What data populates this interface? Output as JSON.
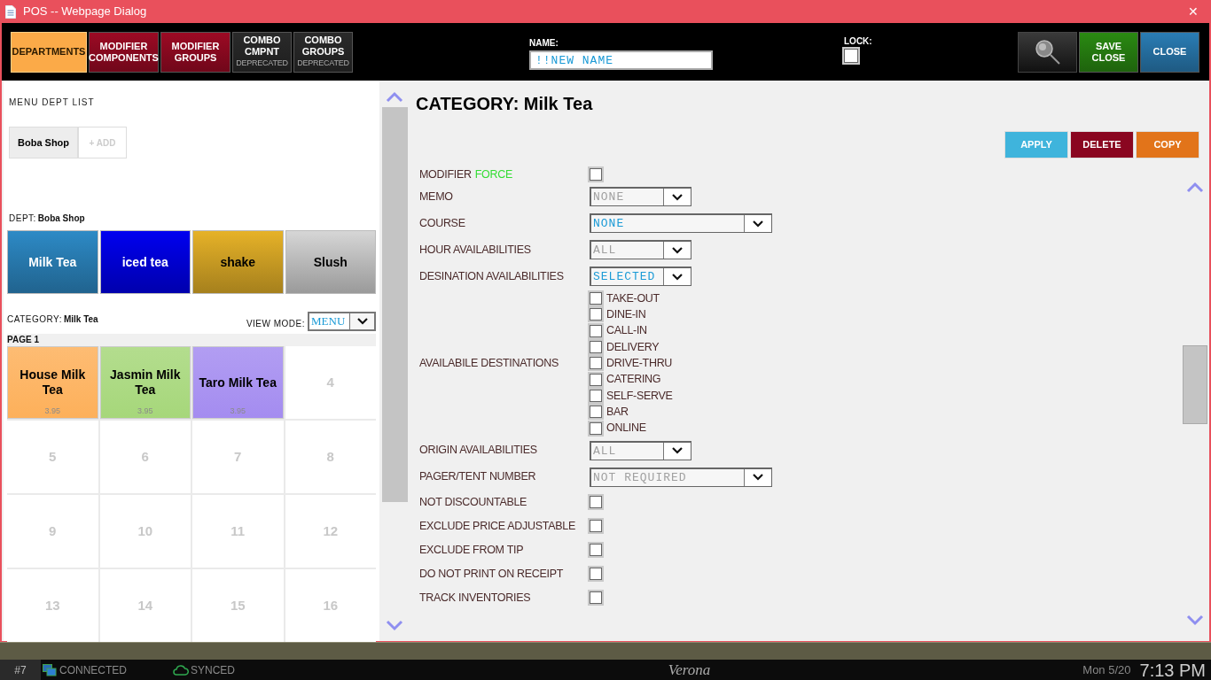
{
  "window": {
    "title": "POS -- Webpage Dialog",
    "close": "✕"
  },
  "tabs": [
    {
      "label": "DEPARTMENTS",
      "selected": true,
      "color": "#fbaa48"
    },
    {
      "label": "MODIFIER COMPONENTS",
      "selected": false,
      "color": "#9c0a24"
    },
    {
      "label": "MODIFIER GROUPS",
      "selected": false,
      "color": "#9c0a24"
    },
    {
      "label": "COMBO CMPNT",
      "note": "DEPRECATED",
      "selected": false,
      "color": "#2a2a2a"
    },
    {
      "label": "COMBO GROUPS",
      "note": "DEPRECATED",
      "selected": false,
      "color": "#2a2a2a"
    }
  ],
  "name_field": {
    "label": "NAME:",
    "value": "!!NEW NAME"
  },
  "lock": {
    "label": "LOCK:",
    "checked": false
  },
  "header_buttons": [
    {
      "kind": "search"
    },
    {
      "kind": "text",
      "label": "SAVE CLOSE",
      "color": "#2a8a12"
    },
    {
      "kind": "text",
      "label": "CLOSE",
      "color": "#2a7db5"
    }
  ],
  "menu_dept_list": {
    "title": "MENU DEPT LIST",
    "departments": [
      {
        "label": "Boba Shop",
        "selected": true
      }
    ],
    "add_button": "+ ADD"
  },
  "dept": {
    "label": "DEPT:",
    "value": "Boba Shop",
    "categories": [
      {
        "label": "Milk Tea",
        "color": "#2d8ac6"
      },
      {
        "label": "iced tea",
        "color": "#0000f0"
      },
      {
        "label": "shake",
        "color": "#e6b228"
      },
      {
        "label": "Slush",
        "color": "#d6d6d6"
      }
    ]
  },
  "category": {
    "label": "CATEGORY:",
    "value": "Milk Tea"
  },
  "view_mode": {
    "label": "VIEW MODE:",
    "value": "MENU"
  },
  "page_label": "PAGE 1",
  "items": [
    {
      "kind": "item",
      "name": "House Milk Tea",
      "price": "3.95",
      "color": "#fdb05a"
    },
    {
      "kind": "item",
      "name": "Jasmin Milk Tea",
      "price": "3.95",
      "color": "#a6d77a"
    },
    {
      "kind": "item",
      "name": "Taro Milk Tea",
      "price": "3.95",
      "color": "#a48cf0"
    },
    {
      "kind": "empty",
      "name": "4"
    },
    {
      "kind": "empty",
      "name": "5"
    },
    {
      "kind": "empty",
      "name": "6"
    },
    {
      "kind": "empty",
      "name": "7"
    },
    {
      "kind": "empty",
      "name": "8"
    },
    {
      "kind": "empty",
      "name": "9"
    },
    {
      "kind": "empty",
      "name": "10"
    },
    {
      "kind": "empty",
      "name": "11"
    },
    {
      "kind": "empty",
      "name": "12"
    },
    {
      "kind": "empty",
      "name": "13"
    },
    {
      "kind": "empty",
      "name": "14"
    },
    {
      "kind": "empty",
      "name": "15"
    },
    {
      "kind": "empty",
      "name": "16"
    }
  ],
  "detail": {
    "title": "CATEGORY: Milk Tea",
    "actions": [
      {
        "label": "APPLY",
        "color": "#3fb4dc"
      },
      {
        "label": "DELETE",
        "color": "#8a0620"
      },
      {
        "label": "COPY",
        "color": "#e2741a"
      }
    ],
    "rows": [
      {
        "kind": "checkbox",
        "label": "MODIFIER",
        "label_accent": "FORCE",
        "checked": false
      },
      {
        "kind": "select",
        "label": "MEMO",
        "value": "NONE",
        "disabled": true,
        "wide": false
      },
      {
        "kind": "select",
        "label": "COURSE",
        "value": "NONE",
        "disabled": false,
        "wide": true
      },
      {
        "kind": "select",
        "label": "HOUR AVAILABILITIES",
        "value": "ALL",
        "disabled": true,
        "wide": false
      },
      {
        "kind": "select",
        "label": "DESINATION AVAILABILITIES",
        "value": "SELECTED",
        "disabled": false,
        "wide": false
      },
      {
        "kind": "checklist",
        "label": "AVAILABILE DESTINATIONS",
        "options": [
          {
            "label": "TAKE-OUT",
            "checked": false
          },
          {
            "label": "DINE-IN",
            "checked": false
          },
          {
            "label": "CALL-IN",
            "checked": false
          },
          {
            "label": "DELIVERY",
            "checked": false
          },
          {
            "label": "DRIVE-THRU",
            "checked": false
          },
          {
            "label": "CATERING",
            "checked": false
          },
          {
            "label": "SELF-SERVE",
            "checked": false
          },
          {
            "label": "BAR",
            "checked": false
          },
          {
            "label": "ONLINE",
            "checked": false
          }
        ]
      },
      {
        "kind": "select",
        "label": "ORIGIN AVAILABILITIES",
        "value": "ALL",
        "disabled": true,
        "wide": false
      },
      {
        "kind": "select",
        "label": "PAGER/TENT NUMBER",
        "value": "NOT REQUIRED",
        "disabled": true,
        "wide": true
      },
      {
        "kind": "checkbox",
        "label": "NOT DISCOUNTABLE",
        "checked": false
      },
      {
        "kind": "checkbox",
        "label": "EXCLUDE PRICE ADJUSTABLE",
        "checked": false
      },
      {
        "kind": "checkbox",
        "label": "EXCLUDE FROM TIP",
        "checked": false
      },
      {
        "kind": "checkbox",
        "label": "DO NOT PRINT ON RECEIPT",
        "checked": false
      },
      {
        "kind": "checkbox",
        "label": "TRACK INVENTORIES",
        "checked": false
      }
    ]
  },
  "status_bar": {
    "station": "#7",
    "connection": "CONNECTED",
    "sync": "SYNCED",
    "location": "Verona",
    "date": "Mon 5/20",
    "time": "7:13 PM"
  }
}
